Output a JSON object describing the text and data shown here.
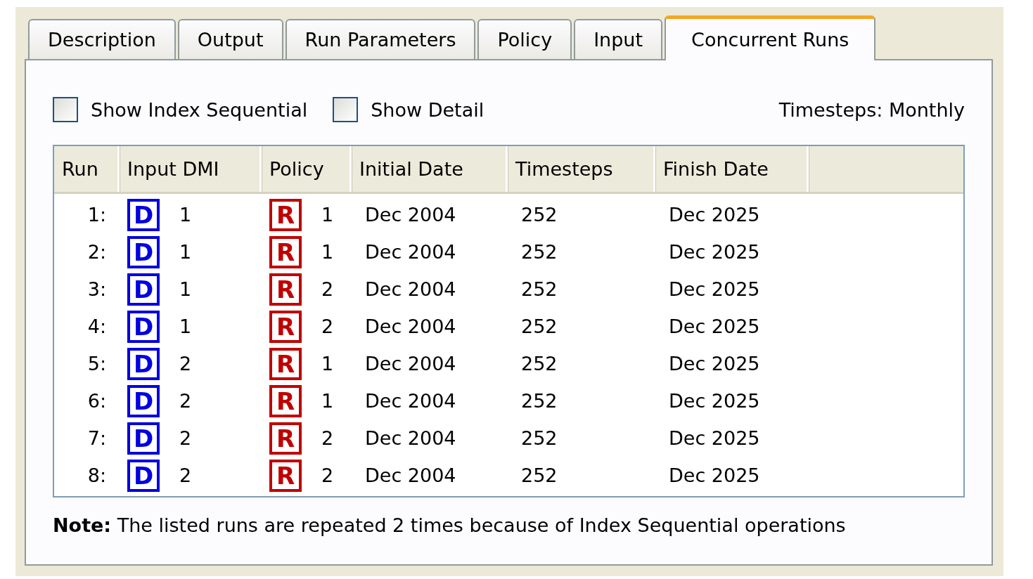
{
  "tabs": [
    {
      "label": "Description",
      "selected": false
    },
    {
      "label": "Output",
      "selected": false
    },
    {
      "label": "Run Parameters",
      "selected": false
    },
    {
      "label": "Policy",
      "selected": false
    },
    {
      "label": "Input",
      "selected": false
    },
    {
      "label": "Concurrent Runs",
      "selected": true
    }
  ],
  "options": [
    {
      "label": "Show Index Sequential",
      "checked": false
    },
    {
      "label": "Show Detail",
      "checked": false
    }
  ],
  "timesteps_label": "Timesteps: Monthly",
  "table": {
    "columns": [
      "Run",
      "Input DMI",
      "Policy",
      "Initial Date",
      "Timesteps",
      "Finish Date"
    ],
    "rows": [
      {
        "run": "1:",
        "dmi": {
          "kind": "dmi",
          "badge": "D",
          "value": "1"
        },
        "policy": {
          "kind": "rule",
          "badge": "R",
          "value": "1"
        },
        "initial_date": "Dec 2004",
        "timesteps": "252",
        "finish_date": "Dec 2025"
      },
      {
        "run": "2:",
        "dmi": {
          "kind": "dmi",
          "badge": "D",
          "value": "1"
        },
        "policy": {
          "kind": "rule",
          "badge": "R",
          "value": "1"
        },
        "initial_date": "Dec 2004",
        "timesteps": "252",
        "finish_date": "Dec 2025"
      },
      {
        "run": "3:",
        "dmi": {
          "kind": "dmi",
          "badge": "D",
          "value": "1"
        },
        "policy": {
          "kind": "rule",
          "badge": "R",
          "value": "2"
        },
        "initial_date": "Dec 2004",
        "timesteps": "252",
        "finish_date": "Dec 2025"
      },
      {
        "run": "4:",
        "dmi": {
          "kind": "dmi",
          "badge": "D",
          "value": "1"
        },
        "policy": {
          "kind": "rule",
          "badge": "R",
          "value": "2"
        },
        "initial_date": "Dec 2004",
        "timesteps": "252",
        "finish_date": "Dec 2025"
      },
      {
        "run": "5:",
        "dmi": {
          "kind": "dmi",
          "badge": "D",
          "value": "2"
        },
        "policy": {
          "kind": "rule",
          "badge": "R",
          "value": "1"
        },
        "initial_date": "Dec 2004",
        "timesteps": "252",
        "finish_date": "Dec 2025"
      },
      {
        "run": "6:",
        "dmi": {
          "kind": "dmi",
          "badge": "D",
          "value": "2"
        },
        "policy": {
          "kind": "rule",
          "badge": "R",
          "value": "1"
        },
        "initial_date": "Dec 2004",
        "timesteps": "252",
        "finish_date": "Dec 2025"
      },
      {
        "run": "7:",
        "dmi": {
          "kind": "dmi",
          "badge": "D",
          "value": "2"
        },
        "policy": {
          "kind": "rule",
          "badge": "R",
          "value": "2"
        },
        "initial_date": "Dec 2004",
        "timesteps": "252",
        "finish_date": "Dec 2025"
      },
      {
        "run": "8:",
        "dmi": {
          "kind": "dmi",
          "badge": "D",
          "value": "2"
        },
        "policy": {
          "kind": "rule",
          "badge": "R",
          "value": "2"
        },
        "initial_date": "Dec 2004",
        "timesteps": "252",
        "finish_date": "Dec 2025"
      }
    ]
  },
  "note": "**Note:** The listed runs are repeated 2 times because of Index Sequential operations"
}
